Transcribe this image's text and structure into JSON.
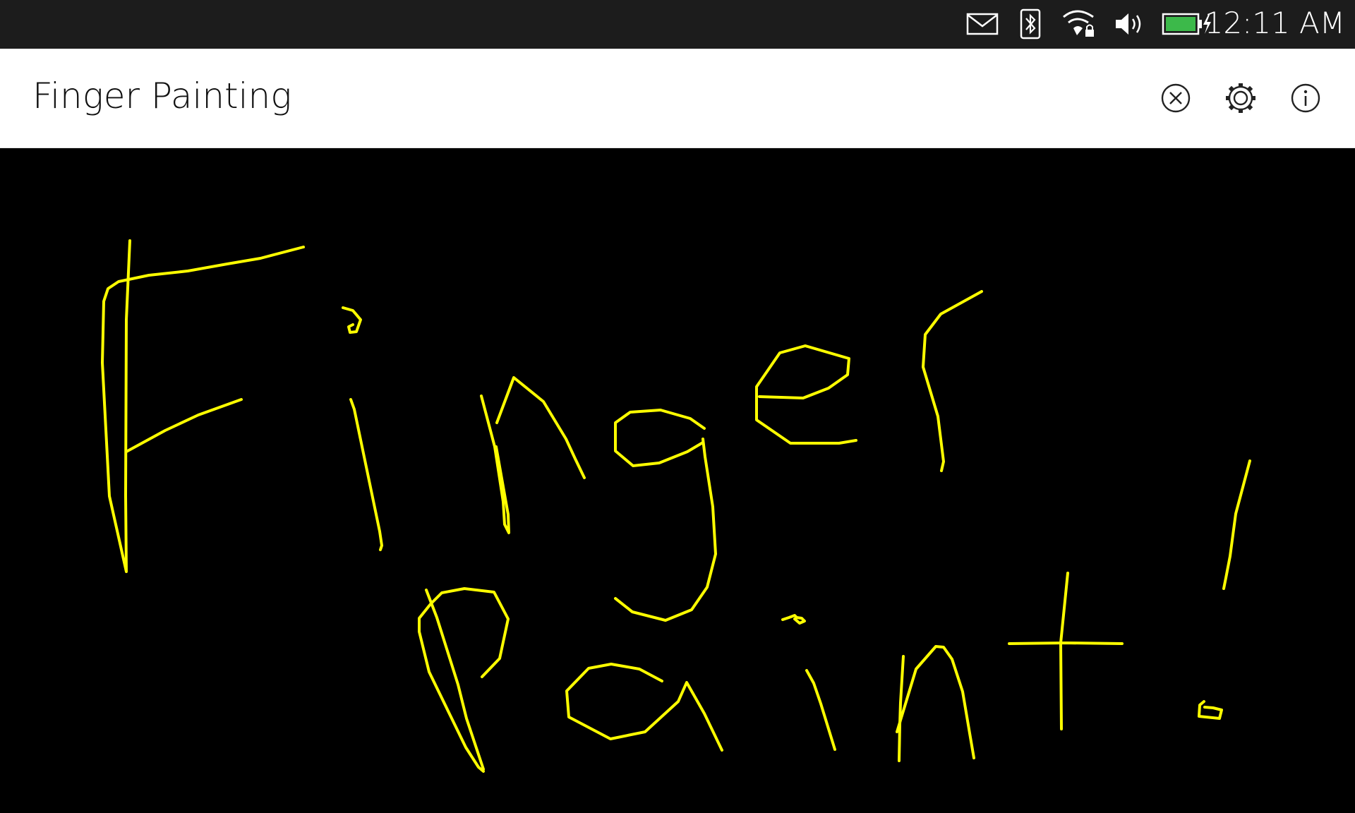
{
  "status_bar": {
    "time": "12:11 AM",
    "icons": [
      "mail-icon",
      "bluetooth-icon",
      "wifi-locked-icon",
      "volume-icon",
      "battery-charging-icon"
    ],
    "battery_color": "#3cb94a"
  },
  "header": {
    "title": "Finger Painting",
    "actions": [
      "clear-icon",
      "settings-icon",
      "info-icon"
    ]
  },
  "canvas": {
    "background": "#000000",
    "stroke_color": "#ffff00",
    "drawn_text": "Finger Paint!"
  }
}
